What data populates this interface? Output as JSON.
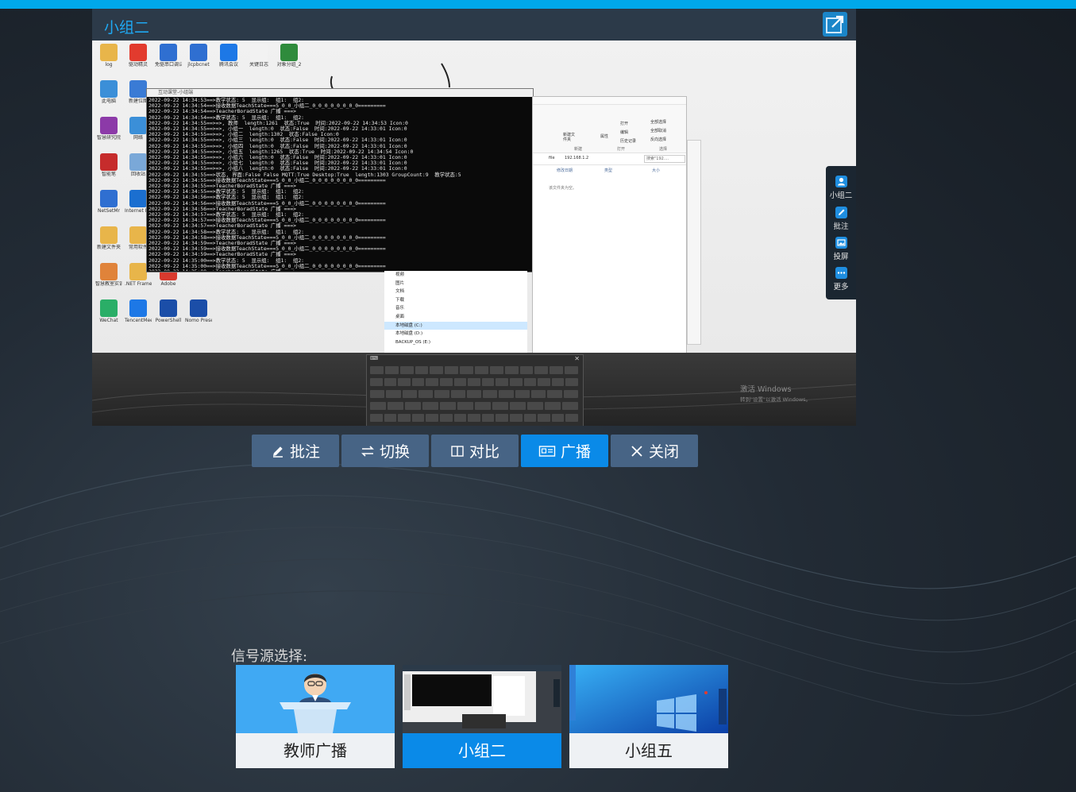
{
  "panel": {
    "title": "小组二",
    "expand_icon": "expand-arrow-icon"
  },
  "desktop": {
    "icons": [
      {
        "label": "log",
        "color": "#e8b54a"
      },
      {
        "label": "驱动精灵",
        "color": "#e23b2e"
      },
      {
        "label": "免驱串口调试工具",
        "color": "#2f6fd1"
      },
      {
        "label": "jlcpbcnet",
        "color": "#2f6fd1"
      },
      {
        "label": "腾讯会议",
        "color": "#1d78e6"
      },
      {
        "label": "关键日志",
        "color": "#f2f2f2"
      },
      {
        "label": "对象分组_2",
        "color": "#2f8b3c"
      },
      {
        "label": "此电脑",
        "color": "#3b8fd8"
      },
      {
        "label": "新建位图",
        "color": "#3a7bd5"
      },
      {
        "label": "智慧研究院",
        "color": "#8c3aa8"
      },
      {
        "label": "网络",
        "color": "#3b8fd8"
      },
      {
        "label": "智能笔",
        "color": "#c62c2c"
      },
      {
        "label": "回收站",
        "color": "#7aa8d8"
      },
      {
        "label": "NetSetMr",
        "color": "#2f6fd1"
      },
      {
        "label": "Internet Explorer",
        "color": "#1b6fd0"
      },
      {
        "label": "新建文件夹",
        "color": "#e8b54a"
      },
      {
        "label": "常用软件",
        "color": "#e8b54a"
      },
      {
        "label": "智慧教室实训",
        "color": "#e0833a"
      },
      {
        "label": ".NET Framework",
        "color": "#e8b54a"
      },
      {
        "label": "Adobe",
        "color": "#d83a2e"
      },
      {
        "label": "WeChat",
        "color": "#2aae67"
      },
      {
        "label": "TencentMeeting",
        "color": "#1d78e6"
      },
      {
        "label": "PowerShell",
        "color": "#1b4ea8"
      },
      {
        "label": "Nomo Presenter",
        "color": "#1b4ea8"
      }
    ],
    "console_title": "互动课堂-小组端",
    "console_lines": [
      "2022-09-22 14:34:53==>教学状态: 5  显示组:  组1:  组2:",
      "2022-09-22 14:34:54==>接收数据TeachState===5_0_0_小组二_0_0_0_0_0_0_0_0=========",
      "2022-09-22 14:34:54==>TeacherBoradState 广播 ===>",
      "2022-09-22 14:34:54==>教学状态: 5  显示组:  组1:  组2:",
      "2022-09-22 14:34:55==>=>, 教师  length:1261  状态:True  时间:2022-09-22 14:34:53 Icon:0",
      "2022-09-22 14:34:55==>=>, 小组一  length:0  状态:False  时间:2022-09-22 14:33:01 Icon:0",
      "2022-09-22 14:34:55==>=>, 小组二  length:1302  状态:False Icon:0",
      "2022-09-22 14:34:55==>=>, 小组三  length:0  状态:False  时间:2022-09-22 14:33:01 Icon:0",
      "2022-09-22 14:34:55==>=>, 小组四  length:0  状态:False  时间:2022-09-22 14:33:01 Icon:0",
      "2022-09-22 14:34:55==>=>, 小组五  length:1265  状态:True  时间:2022-09-22 14:34:54 Icon:0",
      "2022-09-22 14:34:55==>=>, 小组六  length:0  状态:False  时间:2022-09-22 14:33:01 Icon:0",
      "2022-09-22 14:34:55==>=>, 小组七  length:0  状态:False  时间:2022-09-22 14:33:01 Icon:0",
      "2022-09-22 14:34:55==>=>, 小组八  length:0  状态:False  时间:2022-09-22 14:33:01 Icon:0",
      "2022-09-22 14:34:55==>状态, 界面:False False MQTT:True Desktop:True  length:1303 GroupCount:9  教学状态:5",
      "2022-09-22 14:34:55==>接收数据TeachState===5_0_0_小组二_0_0_0_0_0_0_0_0=========",
      "2022-09-22 14:34:55==>TeacherBoradState 广播 ===>",
      "2022-09-22 14:34:55==>教学状态: 5  显示组:  组1:  组2:",
      "2022-09-22 14:34:56==>教学状态: 5  显示组:  组1:  组2:",
      "2022-09-22 14:34:56==>接收数据TeachState===5_0_0_小组二_0_0_0_0_0_0_0_0=========",
      "2022-09-22 14:34:56==>TeacherBoradState 广播 ===>",
      "2022-09-22 14:34:57==>教学状态: 5  显示组:  组1:  组2:",
      "2022-09-22 14:34:57==>接收数据TeachState===5_0_0_小组二_0_0_0_0_0_0_0_0=========",
      "2022-09-22 14:34:57==>TeacherBoradState 广播 ===>",
      "2022-09-22 14:34:58==>教学状态: 5  显示组:  组1:  组2:",
      "2022-09-22 14:34:58==>接收数据TeachState===5_0_0_小组二_0_0_0_0_0_0_0_0=========",
      "2022-09-22 14:34:59==>TeacherBoradState 广播 ===>",
      "2022-09-22 14:34:59==>接收数据TeachState===5_0_0_小组二_0_0_0_0_0_0_0_0=========",
      "2022-09-22 14:34:59==>TeacherBoradState 广播 ===>",
      "2022-09-22 14:35:00==>教学状态: 5  显示组:  组1:  组2:",
      "2022-09-22 14:35:00==>接收数据TeachState===5_0_0_小组二_0_0_0_0_0_0_0_0=========",
      "2022-09-22 14:35:00==>TeacherBoradState 广播 ===>"
    ],
    "explorer": {
      "address": "192.168.1.2",
      "path_prefix": "file",
      "search_placeholder": "搜索\"192....",
      "ribbon": [
        "打开",
        "编辑",
        "历史记录",
        "全部选择",
        "全部取消",
        "反向选择"
      ],
      "ribbon_groups": [
        "新建",
        "打开",
        "选择"
      ],
      "new_folder": "新建文件夹",
      "attrs": "属性",
      "columns": [
        "修改日期",
        "类型",
        "大小"
      ],
      "empty_text": "该文件夹为空。",
      "nav": [
        "视频",
        "图片",
        "文档",
        "下载",
        "音乐",
        "桌面",
        "本地磁盘 (C:)",
        "本地磁盘 (D:)",
        "BACKUP_OS (E:)"
      ]
    },
    "activate_windows": "激活 Windows",
    "activate_hint": "转到\"设置\"以激活 Windows。"
  },
  "sidebar": {
    "items": [
      {
        "label": "小组二",
        "icon": "user-icon"
      },
      {
        "label": "批注",
        "icon": "edit-icon"
      },
      {
        "label": "投屏",
        "icon": "image-icon"
      },
      {
        "label": "更多",
        "icon": "more-icon"
      }
    ]
  },
  "actions": {
    "annotate": "批注",
    "switch": "切换",
    "compare": "对比",
    "broadcast": "广播",
    "close": "关闭"
  },
  "sources": {
    "title": "信号源选择:",
    "items": [
      {
        "label": "教师广播"
      },
      {
        "label": "小组二"
      },
      {
        "label": "小组五"
      }
    ]
  },
  "colors": {
    "accent": "#0a8ae8",
    "button": "#476485",
    "top_strip": "#00a8ea"
  }
}
